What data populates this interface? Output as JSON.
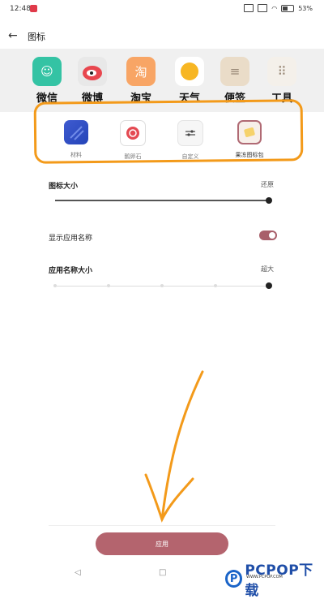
{
  "status": {
    "time": "12:48",
    "battery": "53%"
  },
  "header": {
    "title": "图标"
  },
  "preview_apps": [
    {
      "label": "微信",
      "color": "#34c3a4",
      "glyph": "☺"
    },
    {
      "label": "微博",
      "color": "#e8e8e8",
      "glyph": "◉"
    },
    {
      "label": "淘宝",
      "color": "#f8a565",
      "glyph": "淘"
    },
    {
      "label": "天气",
      "color": "#ffffff",
      "glyph": ""
    },
    {
      "label": "便签",
      "color": "#eadcc8",
      "glyph": "≡"
    },
    {
      "label": "工具",
      "color": "#f4f0ea",
      "glyph": "⠿"
    }
  ],
  "style_options": [
    {
      "name": "材料"
    },
    {
      "name": "鹅卵石"
    },
    {
      "name": "自定义"
    },
    {
      "name": "果冻图标包"
    }
  ],
  "settings": {
    "icon_size_label": "图标大小",
    "icon_size_reset": "还原",
    "icon_size_level": 1.0,
    "show_app_name_label": "显示应用名称",
    "show_app_name_on": true,
    "app_name_size_label": "应用名称大小",
    "app_name_size_value": "超大",
    "app_name_size_level": 1.0
  },
  "apply_button": "应用",
  "nav": {
    "back": "◁",
    "home": "□"
  },
  "watermark": {
    "brand": "PCPOP下载",
    "sub": "WWW.PCPOP.COM"
  },
  "colors": {
    "accent": "#b4646e",
    "highlight": "#f39a1a"
  }
}
